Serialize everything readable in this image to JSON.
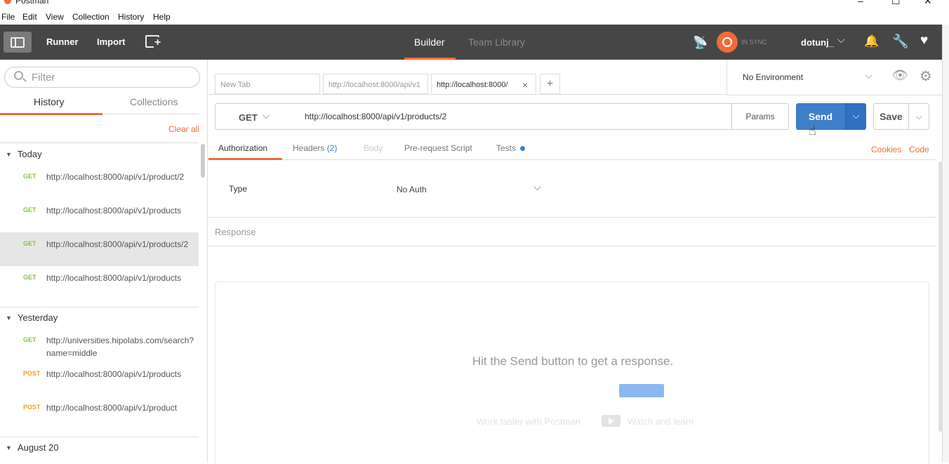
{
  "window": {
    "title": "Postman",
    "minimize": "–",
    "maximize": "☐",
    "close": "✕"
  },
  "menu": [
    "File",
    "Edit",
    "View",
    "Collection",
    "History",
    "Help"
  ],
  "toolbar": {
    "runner": "Runner",
    "import": "Import",
    "builder": "Builder",
    "team_library": "Team Library",
    "sync_status": "IN SYNC",
    "username": "dotunj_",
    "chevron": "⌵",
    "icons": {
      "satellite": "satellite-icon",
      "bell": "bell-icon",
      "wrench": "wrench-icon",
      "heart": "heart-icon"
    }
  },
  "sidebar": {
    "filter_placeholder": "Filter",
    "tabs": {
      "history": "History",
      "collections": "Collections"
    },
    "clear_all": "Clear all",
    "groups": [
      {
        "label": "Today",
        "items": [
          {
            "method": "GET",
            "url": "http://localhost:8000/api/v1/product/2"
          },
          {
            "method": "GET",
            "url": "http://localhost:8000/api/v1/products"
          },
          {
            "method": "GET",
            "url": "http://localhost:8000/api/v1/products/2",
            "selected": true
          },
          {
            "method": "GET",
            "url": "http://localhost:8000/api/v1/products"
          }
        ]
      },
      {
        "label": "Yesterday",
        "items": [
          {
            "method": "GET",
            "url": "http://universities.hipolabs.com/search?name=middle"
          },
          {
            "method": "POST",
            "url": "http://localhost:8000/api/v1/products"
          },
          {
            "method": "POST",
            "url": "http://localhost:8000/api/v1/product"
          }
        ]
      },
      {
        "label": "August 20",
        "items": []
      }
    ]
  },
  "request_tabs": [
    {
      "label": "New Tab"
    },
    {
      "label": "http://localhost:8000/api/v1"
    },
    {
      "label": "http://localhost:8000/",
      "active": true
    }
  ],
  "tab_close": "×",
  "tab_add": "+",
  "environment": {
    "selected": "No Environment"
  },
  "request": {
    "method": "GET",
    "url": "http://localhost:8000/api/v1/products/2",
    "params": "Params",
    "send": "Send",
    "save": "Save"
  },
  "subtabs": {
    "authorization": "Authorization",
    "headers": "Headers",
    "headers_count": "(2)",
    "body": "Body",
    "prerequest": "Pre-request Script",
    "tests": "Tests",
    "cookies": "Cookies",
    "code": "Code"
  },
  "auth": {
    "type_label": "Type",
    "type_value": "No Auth"
  },
  "response": {
    "label": "Response",
    "hint": "Hit the Send button to get a response.",
    "promo_left": "Work faster with Postman",
    "promo_right": "Watch and learn"
  },
  "colors": {
    "accent": "#f26b3a",
    "send": "#3e7fca",
    "get": "#86c441",
    "post": "#f0a020",
    "toolbar": "#464646"
  }
}
